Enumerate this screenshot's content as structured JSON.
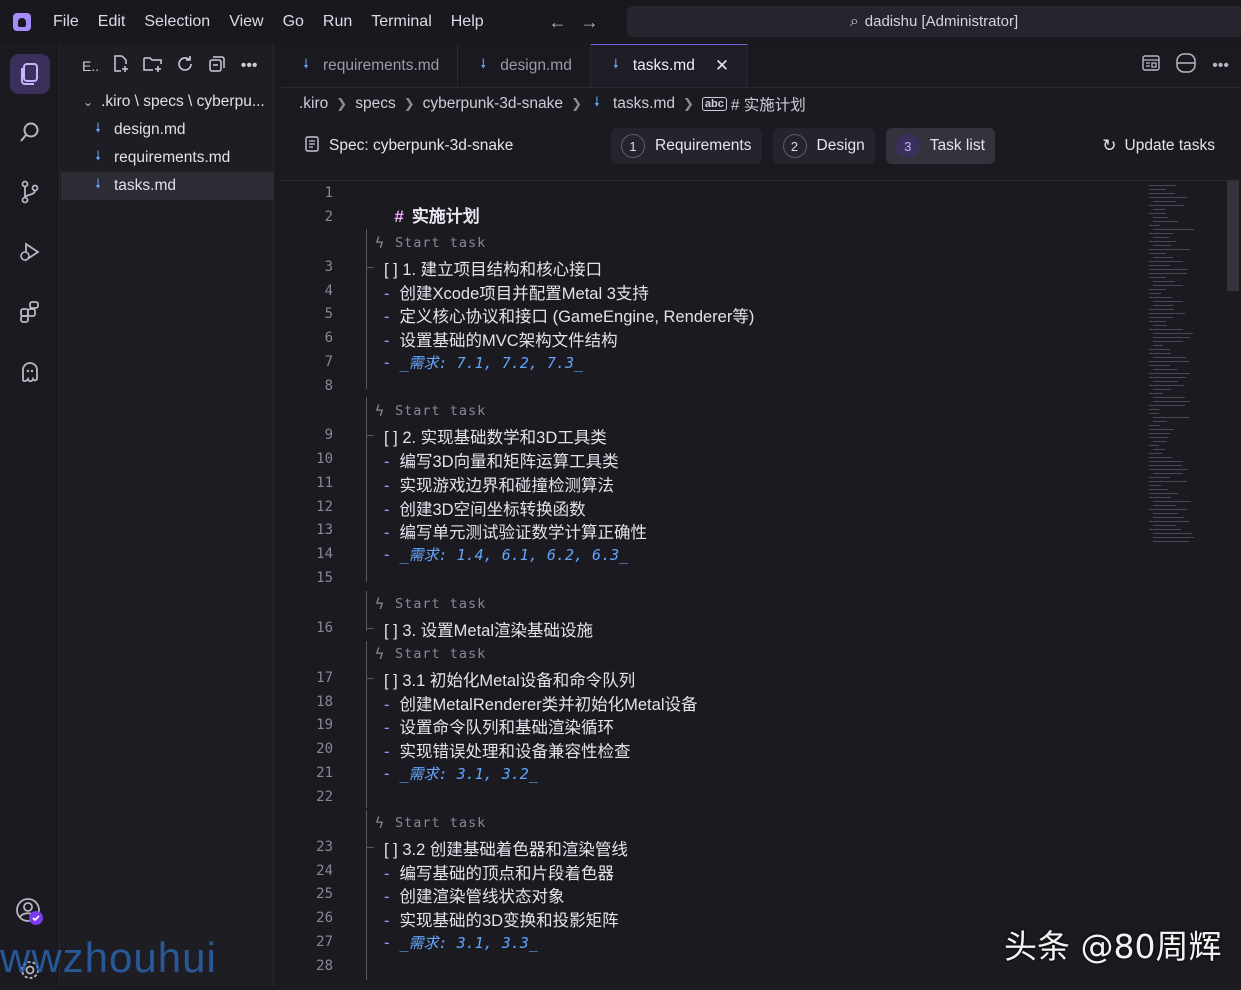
{
  "menu": [
    "File",
    "Edit",
    "Selection",
    "View",
    "Go",
    "Run",
    "Terminal",
    "Help"
  ],
  "search": {
    "label": "dadishu [Administrator]"
  },
  "sidebar": {
    "title": "E..",
    "path": ".kiro \\ specs \\ cyberpu...",
    "files": [
      "design.md",
      "requirements.md",
      "tasks.md"
    ]
  },
  "tabs": [
    "requirements.md",
    "design.md",
    "tasks.md"
  ],
  "breadcrumb": [
    ".kiro",
    "specs",
    "cyberpunk-3d-snake",
    "tasks.md",
    "# 实施计划"
  ],
  "spec": {
    "title": "Spec: cyberpunk-3d-snake",
    "steps": [
      {
        "num": "1",
        "label": "Requirements"
      },
      {
        "num": "2",
        "label": "Design"
      },
      {
        "num": "3",
        "label": "Task list"
      }
    ],
    "update_label": "Update tasks"
  },
  "codelens_label": "Start task",
  "editor_lines": {
    "l1": "实施计划",
    "l3": "[ ] 1. 建立项目结构和核心接口",
    "l4": "创建Xcode项目并配置Metal 3支持",
    "l5": "定义核心协议和接口 (GameEngine, Renderer等)",
    "l6": "设置基础的MVC架构文件结构",
    "l7": "_需求: 7.1, 7.2, 7.3_",
    "l9": "[ ] 2. 实现基础数学和3D工具类",
    "l10": "编写3D向量和矩阵运算工具类",
    "l11": "实现游戏边界和碰撞检测算法",
    "l12": "创建3D空间坐标转换函数",
    "l13": "编写单元测试验证数学计算正确性",
    "l14": "_需求: 1.4, 6.1, 6.2, 6.3_",
    "l16": "[ ] 3. 设置Metal渲染基础设施",
    "l17": "[ ] 3.1 初始化Metal设备和命令队列",
    "l18": "创建MetalRenderer类并初始化Metal设备",
    "l19": "设置命令队列和基础渲染循环",
    "l20": "实现错误处理和设备兼容性检查",
    "l21": "_需求: 3.1, 3.2_",
    "l23": "[ ] 3.2 创建基础着色器和渲染管线",
    "l24": "编写基础的顶点和片段着色器",
    "l25": "创建渲染管线状态对象",
    "l26": "实现基础的3D变换和投影矩阵",
    "l27": "_需求: 3.1, 3.3_"
  },
  "line_numbers": [
    "1",
    "2",
    "3",
    "4",
    "5",
    "6",
    "7",
    "8",
    "9",
    "10",
    "11",
    "12",
    "13",
    "14",
    "15",
    "16",
    "17",
    "18",
    "19",
    "20",
    "21",
    "22",
    "23",
    "24",
    "25",
    "26",
    "27",
    "28"
  ],
  "watermarks": {
    "left": "wwzhouhui",
    "right": "头条 @80周辉"
  }
}
